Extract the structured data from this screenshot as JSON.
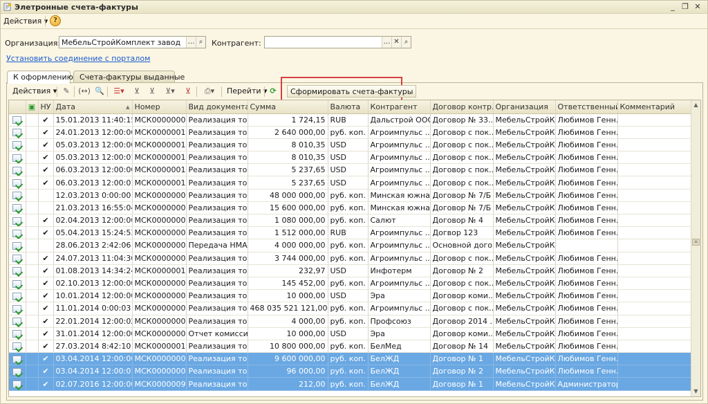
{
  "window": {
    "title": "Элетронные счета-фактуры",
    "controls": [
      "_",
      "❐",
      "✕"
    ]
  },
  "menubar": {
    "actions_label": "Действия ▾",
    "help_label": "?"
  },
  "filters": {
    "org_label": "Организация:",
    "org_value": "МебельСтройКомплект завод",
    "contractor_label": "Контрагент:",
    "contractor_value": "",
    "portal_link": "Установить соединение с порталом"
  },
  "tabs": [
    {
      "label": "К оформлению"
    },
    {
      "label": "Счета-фактуры выданные"
    }
  ],
  "toolbar": {
    "actions_label": "Действия ▾",
    "goto_label": "Перейти ▾",
    "generate_label": "Сформировать счета-фактуры"
  },
  "table": {
    "columns": [
      "",
      "",
      "НУ",
      "Дата",
      "Номер",
      "Вид документа",
      "Сумма",
      "Валюта",
      "Контрагент",
      "Договор контр...",
      "Организация",
      "Ответственный",
      "Комментарий"
    ],
    "rows": [
      {
        "nu": "✔",
        "date": "15.01.2013 11:40:15",
        "num": "МСК00000003",
        "kind": "Реализация то...",
        "sum": "1 724,15",
        "cur": "RUB",
        "contr": "Дальстрой ООО",
        "dog": "Договор № 33...",
        "org": "МебельСтройК...",
        "resp": "Любимов Генн...",
        "sel": false
      },
      {
        "nu": "✔",
        "date": "24.01.2013 12:00:00",
        "num": "МСК00000015",
        "kind": "Реализация то...",
        "sum": "2 640 000,00",
        "cur": "руб. коп.",
        "contr": "Агроимпульс ...",
        "dog": "Договор с пок...",
        "org": "МебельСтройК...",
        "resp": "Любимов Генн...",
        "sel": false
      },
      {
        "nu": "✔",
        "date": "05.03.2013 12:00:00",
        "num": "МСК00000010",
        "kind": "Реализация то...",
        "sum": "8 010,35",
        "cur": "USD",
        "contr": "Агроимпульс ...",
        "dog": "Договор с пок...",
        "org": "МебельСтройК...",
        "resp": "Любимов Генн...",
        "sel": false
      },
      {
        "nu": "✔",
        "date": "05.03.2013 12:00:01",
        "num": "МСК00000012",
        "kind": "Реализация то...",
        "sum": "8 010,35",
        "cur": "USD",
        "contr": "Агроимпульс ...",
        "dog": "Договор с пок...",
        "org": "МебельСтройК...",
        "resp": "Любимов Генн...",
        "sel": false
      },
      {
        "nu": "✔",
        "date": "06.03.2013 12:00:00",
        "num": "МСК00000011",
        "kind": "Реализация то...",
        "sum": "5 237,65",
        "cur": "USD",
        "contr": "Агроимпульс ...",
        "dog": "Договор с пок...",
        "org": "МебельСтройК...",
        "resp": "Любимов Генн...",
        "sel": false
      },
      {
        "nu": "✔",
        "date": "06.03.2013 12:00:01",
        "num": "МСК00000013",
        "kind": "Реализация то...",
        "sum": "5 237,65",
        "cur": "USD",
        "contr": "Агроимпульс ...",
        "dog": "Договор с пок...",
        "org": "МебельСтройК...",
        "resp": "Любимов Генн...",
        "sel": false
      },
      {
        "nu": "",
        "date": "12.03.2013 0:00:00",
        "num": "МСК00000004",
        "kind": "Реализация то...",
        "sum": "48 000 000,00",
        "cur": "руб. коп.",
        "contr": "Минская южна...",
        "dog": "Договор № 7/Б",
        "org": "МебельСтройК...",
        "resp": "Любимов Генн...",
        "sel": false
      },
      {
        "nu": "",
        "date": "21.03.2013 16:55:04",
        "num": "МСК00000005",
        "kind": "Реализация то...",
        "sum": "15 600 000,00",
        "cur": "руб. коп.",
        "contr": "Минская южна...",
        "dog": "Договор № 7/Б",
        "org": "МебельСтройК...",
        "resp": "Любимов Генн...",
        "sel": false
      },
      {
        "nu": "✔",
        "date": "02.04.2013 12:00:00",
        "num": "МСК00000008",
        "kind": "Реализация то...",
        "sum": "1 080 000,00",
        "cur": "руб. коп.",
        "contr": "Салют",
        "dog": "Договор № 4",
        "org": "МебельСтройК...",
        "resp": "Любимов Генн...",
        "sel": false
      },
      {
        "nu": "✔",
        "date": "05.04.2013 15:24:53",
        "num": "МСК00000006",
        "kind": "Реализация то...",
        "sum": "1 512 000,00",
        "cur": "RUB",
        "contr": "Агроимпульс ...",
        "dog": "Догвор 123",
        "org": "МебельСтройК...",
        "resp": "Любимов Генн...",
        "sel": false
      },
      {
        "nu": "",
        "date": "28.06.2013 2:42:06",
        "num": "МСК00000004",
        "kind": "Передача НМА",
        "sum": "4 000 000,00",
        "cur": "руб. коп.",
        "contr": "Агроимпульс ...",
        "dog": "Основной дого...",
        "org": "МебельСтройК...",
        "resp": "",
        "sel": false
      },
      {
        "nu": "✔",
        "date": "24.07.2013 11:04:30",
        "num": "МСК00000007",
        "kind": "Реализация то...",
        "sum": "3 744 000,00",
        "cur": "руб. коп.",
        "contr": "Агроимпульс ...",
        "dog": "Договор с пок...",
        "org": "МебельСтройК...",
        "resp": "Любимов Генн...",
        "sel": false
      },
      {
        "nu": "✔",
        "date": "01.08.2013 14:34:24",
        "num": "МСК00000014",
        "kind": "Реализация то...",
        "sum": "232,97",
        "cur": "USD",
        "contr": "Инфотерм",
        "dog": "Договор № 2",
        "org": "МебельСтройК...",
        "resp": "Любимов Генн...",
        "sel": false
      },
      {
        "nu": "✔",
        "date": "02.10.2013 12:00:00",
        "num": "МСК00000009",
        "kind": "Реализация то...",
        "sum": "145 452,00",
        "cur": "руб. коп.",
        "contr": "Агроимпульс ...",
        "dog": "Договор с пок...",
        "org": "МебельСтройК...",
        "resp": "Любимов Генн...",
        "sel": false
      },
      {
        "nu": "✔",
        "date": "10.01.2014 12:00:00",
        "num": "МСК00000006",
        "kind": "Реализация то...",
        "sum": "10 000,00",
        "cur": "USD",
        "contr": "Эра",
        "dog": "Договор коми...",
        "org": "МебельСтройК...",
        "resp": "Любимов Генн...",
        "sel": false
      },
      {
        "nu": "✔",
        "date": "11.01.2014 0:00:03",
        "num": "МСК00000004",
        "kind": "Реализация то...",
        "sum": "468 035 521 121,00",
        "cur": "руб. коп.",
        "contr": "Агроимпульс ...",
        "dog": "Договор с пок...",
        "org": "МебельСтройК...",
        "resp": "Любимов Генн...",
        "sel": false
      },
      {
        "nu": "✔",
        "date": "22.01.2014 12:00:02",
        "num": "МСК00000002",
        "kind": "Реализация то...",
        "sum": "4 000,00",
        "cur": "руб. коп.",
        "contr": "Профсоюз",
        "dog": "Договор 2014 ...",
        "org": "МебельСтройК...",
        "resp": "Любимов Генн...",
        "sel": false
      },
      {
        "nu": "✔",
        "date": "31.01.2014 12:00:00",
        "num": "МСК00000001",
        "kind": "Отчет комисси...",
        "sum": "10 000,00",
        "cur": "USD",
        "contr": "Эра",
        "dog": "Договор коми...",
        "org": "МебельСтройК...",
        "resp": "Любимов Генн...",
        "sel": false
      },
      {
        "nu": "✔",
        "date": "27.03.2014 8:42:10",
        "num": "МСК00000015",
        "kind": "Реализация то...",
        "sum": "10 800 000,00",
        "cur": "руб. коп.",
        "contr": "БелМед",
        "dog": "Договор № 14",
        "org": "МебельСтройК...",
        "resp": "Любимов Генн...",
        "sel": false
      },
      {
        "nu": "✔",
        "date": "03.04.2014 12:00:00",
        "num": "МСК00000007",
        "kind": "Реализация то...",
        "sum": "9 600 000,00",
        "cur": "руб. коп.",
        "contr": "БелЖД",
        "dog": "Договор № 1",
        "org": "МебельСтройК...",
        "resp": "Любимов Генн...",
        "sel": true
      },
      {
        "nu": "✔",
        "date": "03.04.2014 12:00:01",
        "num": "МСК00000008",
        "kind": "Реализация то...",
        "sum": "96 000,00",
        "cur": "руб. коп.",
        "contr": "БелЖД",
        "dog": "Договор № 2",
        "org": "МебельСтройК...",
        "resp": "Любимов Генн...",
        "sel": true
      },
      {
        "nu": "✔",
        "date": "02.07.2016 12:00:00",
        "num": "МСК00000090",
        "kind": "Реализация то...",
        "sum": "212,00",
        "cur": "руб. коп.",
        "contr": "БелЖД",
        "dog": "Договор № 1",
        "org": "МебельСтройК...",
        "resp": "Администратор",
        "sel": true
      }
    ]
  }
}
